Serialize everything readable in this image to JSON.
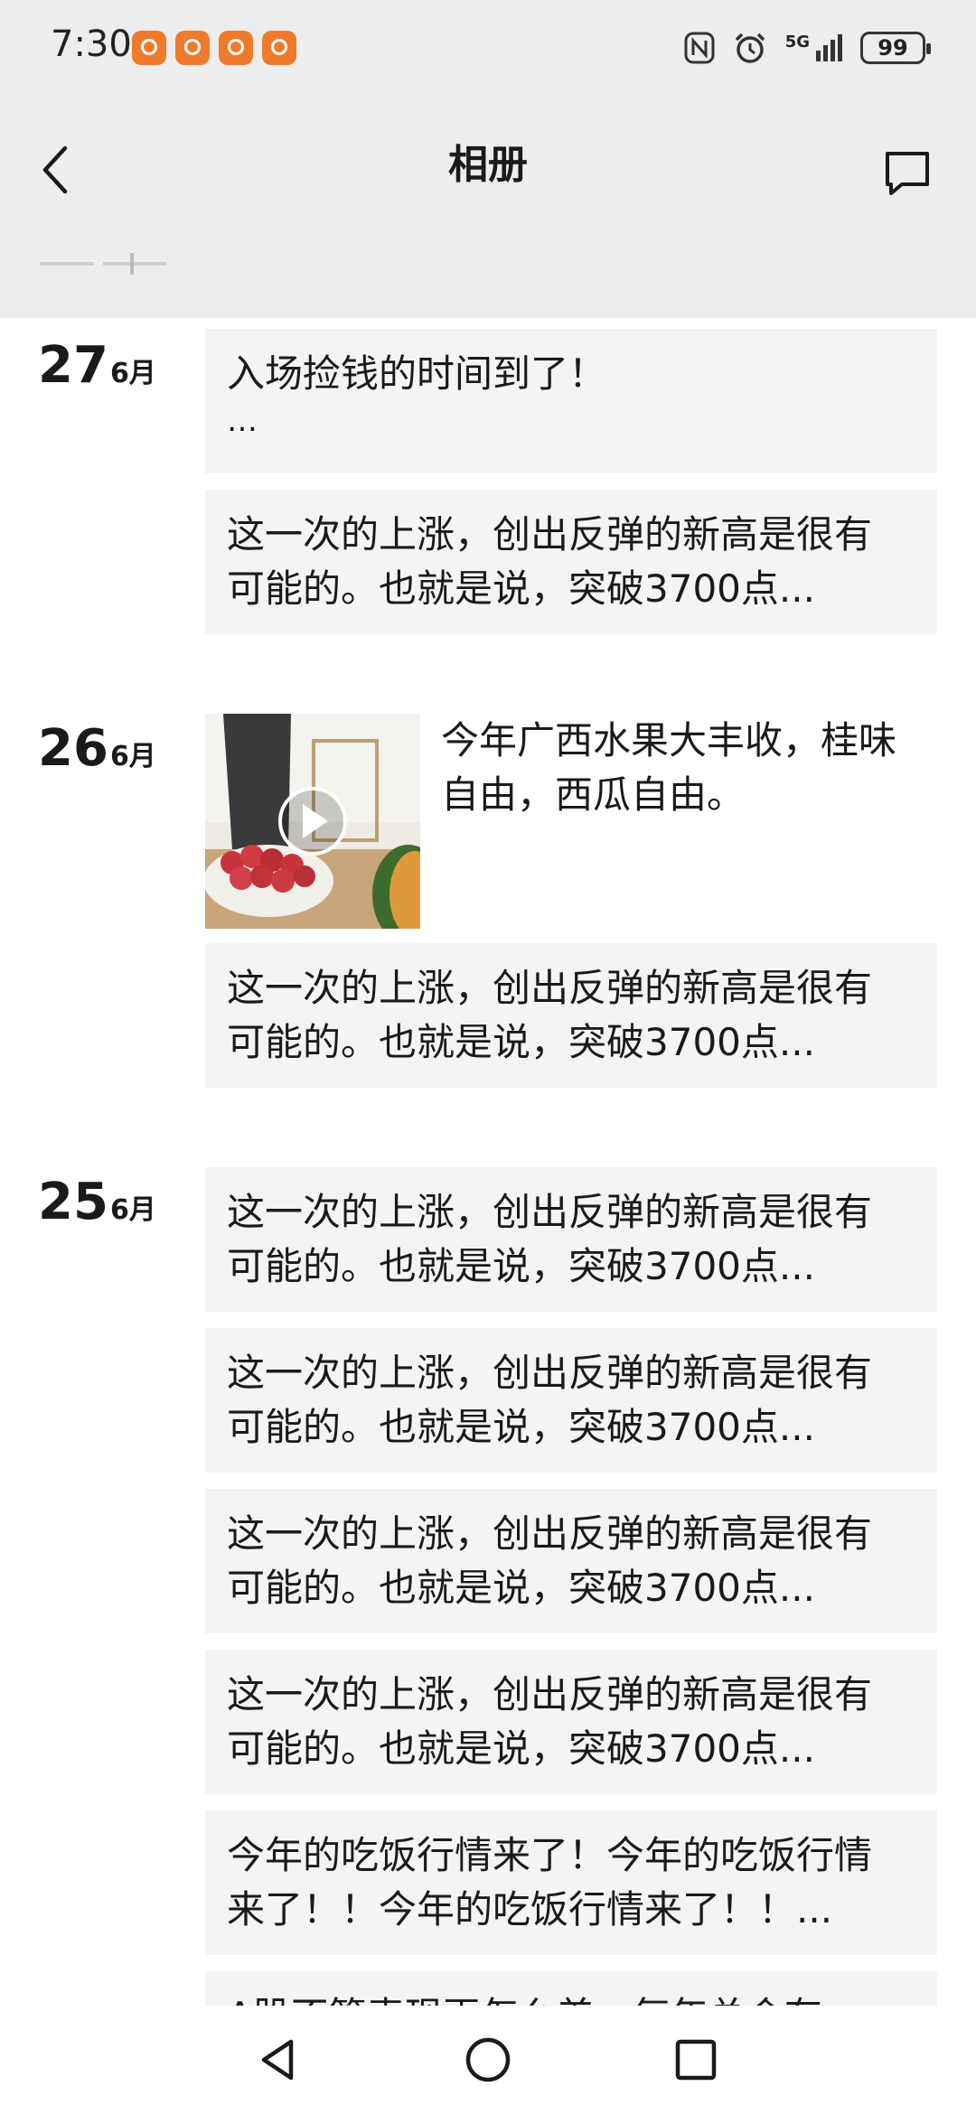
{
  "status_bar": {
    "time": "7:30",
    "notification_icons": [
      "app-notification-icon",
      "app-notification-icon",
      "app-notification-icon",
      "app-notification-icon"
    ],
    "network": "5G",
    "battery": "99"
  },
  "header": {
    "title": "相册"
  },
  "feed": {
    "groups": [
      {
        "day": "27",
        "month": "6月",
        "posts": [
          {
            "line1": "入场捡钱的时间到了！",
            "line2": "…"
          },
          {
            "line1": "这一次的上涨，创出反弹的新高是很有",
            "line2": "可能的。也就是说，突破3700点..."
          }
        ]
      },
      {
        "day": "26",
        "month": "6月",
        "media_post": {
          "line1": "今年广西水果大丰收，桂味",
          "line2": "自由，西瓜自由。"
        },
        "posts": [
          {
            "line1": "这一次的上涨，创出反弹的新高是很有",
            "line2": "可能的。也就是说，突破3700点..."
          }
        ]
      },
      {
        "day": "25",
        "month": "6月",
        "posts": [
          {
            "line1": "这一次的上涨，创出反弹的新高是很有",
            "line2": "可能的。也就是说，突破3700点..."
          },
          {
            "line1": "这一次的上涨，创出反弹的新高是很有",
            "line2": "可能的。也就是说，突破3700点..."
          },
          {
            "line1": "这一次的上涨，创出反弹的新高是很有",
            "line2": "可能的。也就是说，突破3700点..."
          },
          {
            "line1": "这一次的上涨，创出反弹的新高是很有",
            "line2": "可能的。也就是说，突破3700点..."
          },
          {
            "line1": "今年的吃饭行情来了！今年的吃饭行情",
            "line2": "来了！！今年的吃饭行情来了！！..."
          },
          {
            "line1": "A股不管表现再怎么差，每年总会有"
          }
        ]
      }
    ]
  },
  "nav_bar": {
    "icons": [
      "back-triangle-icon",
      "home-circle-icon",
      "recents-square-icon"
    ]
  }
}
